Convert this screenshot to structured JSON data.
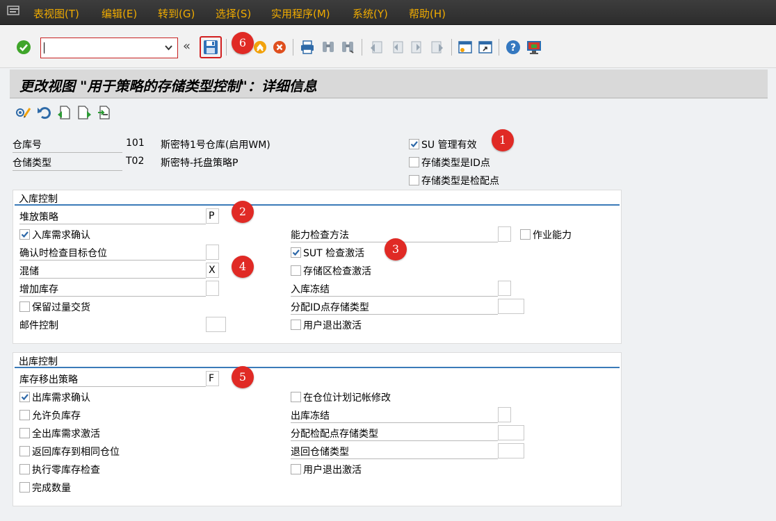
{
  "menu": {
    "items": [
      "表视图(T)",
      "编辑(E)",
      "转到(G)",
      "选择(S)",
      "实用程序(M)",
      "系统(Y)",
      "帮助(H)"
    ]
  },
  "toolbar": {
    "command_value": "",
    "back_glyph": "«"
  },
  "title": "更改视图 \"用于策略的存储类型控制\"：详细信息",
  "header": {
    "warehouse_label": "仓库号",
    "warehouse_value": "101",
    "warehouse_desc": "斯密特1号仓库(启用WM)",
    "storage_type_label": "仓储类型",
    "storage_type_value": "T02",
    "storage_type_desc": "斯密特-托盘策略P",
    "su_mgmt_label": "SU 管理有效",
    "id_point_label": "存储类型是ID点",
    "pick_point_label": "存储类型是检配点"
  },
  "inbound": {
    "title": "入库控制",
    "putaway_label": "堆放策略",
    "putaway_value": "P",
    "confirm_label": "入库需求确认",
    "dest_check_label": "确认时检查目标仓位",
    "mixed_label": "混储",
    "mixed_value": "X",
    "add_stock_label": "增加库存",
    "retain_over_label": "保留过量交货",
    "mail_label": "邮件控制",
    "capacity_method_label": "能力检查方法",
    "work_capacity_label": "作业能力",
    "sut_check_label": "SUT 检查激活",
    "section_check_label": "存储区检查激活",
    "block_label": "入库冻结",
    "assign_id_label": "分配ID点存储类型",
    "user_exit_label": "用户退出激活"
  },
  "outbound": {
    "title": "出库控制",
    "removal_label": "库存移出策略",
    "removal_value": "F",
    "confirm_label": "出库需求确认",
    "neg_stock_label": "允许负库存",
    "full_req_label": "全出库需求激活",
    "return_same_label": "返回库存到相同仓位",
    "zero_check_label": "执行零库存检查",
    "complete_qty_label": "完成数量",
    "bin_change_label": "在仓位计划记帐修改",
    "block_label": "出库冻结",
    "assign_pick_label": "分配检配点存储类型",
    "return_type_label": "退回仓储类型",
    "user_exit_label": "用户退出激活"
  },
  "markers": [
    "1",
    "2",
    "3",
    "4",
    "5",
    "6"
  ],
  "checkboxes": {
    "su_mgmt": true,
    "id_point": false,
    "pick_point": false,
    "in_confirm": true,
    "retain_over": false,
    "work_capacity": false,
    "sut_check": true,
    "section_check": false,
    "in_user_exit": false,
    "out_confirm": true,
    "neg_stock": false,
    "full_req": false,
    "return_same": false,
    "zero_check": false,
    "complete_qty": false,
    "bin_change": false,
    "out_user_exit": false
  },
  "colors": {
    "menu_text": "#f0ab00",
    "accent_line": "#3a7ab8",
    "marker": "#e02a25"
  },
  "icons": [
    "enter-icon",
    "save-icon",
    "back-icon",
    "exit-icon",
    "cancel-icon",
    "print-icon",
    "find-icon",
    "find-next-icon",
    "first-page-icon",
    "prev-page-icon",
    "next-page-icon",
    "last-page-icon",
    "new-session-icon",
    "shortcut-icon",
    "help-icon",
    "layout-icon"
  ]
}
